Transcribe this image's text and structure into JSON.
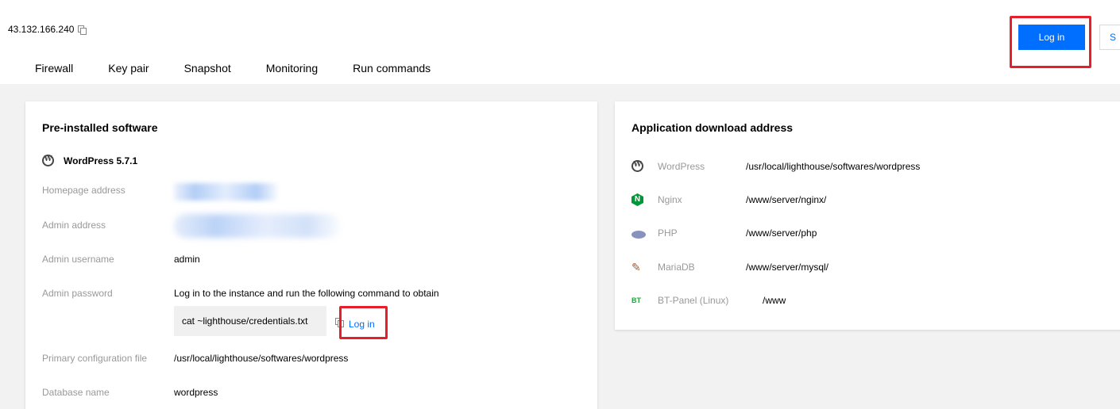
{
  "header": {
    "ip": "43.132.166.240",
    "login_button": "Log in",
    "secondary_button": "S"
  },
  "tabs": [
    "Firewall",
    "Key pair",
    "Snapshot",
    "Monitoring",
    "Run commands"
  ],
  "preinstalled": {
    "title": "Pre-installed software",
    "software_name": "WordPress 5.7.1",
    "fields": {
      "homepage_label": "Homepage address",
      "admin_address_label": "Admin address",
      "admin_username_label": "Admin username",
      "admin_username_value": "admin",
      "admin_password_label": "Admin password",
      "admin_password_hint": "Log in to the instance and run the following command to obtain",
      "command": "cat ~lighthouse/credentials.txt",
      "login_link": "Log in",
      "config_label": "Primary configuration file",
      "config_value": "/usr/local/lighthouse/softwares/wordpress",
      "db_label": "Database name",
      "db_value": "wordpress"
    }
  },
  "apps": {
    "title": "Application download address",
    "items": [
      {
        "icon": "wordpress-icon",
        "name": "WordPress",
        "path": "/usr/local/lighthouse/softwares/wordpress"
      },
      {
        "icon": "nginx-icon",
        "name": "Nginx",
        "path": "/www/server/nginx/"
      },
      {
        "icon": "php-icon",
        "name": "PHP",
        "path": "/www/server/php"
      },
      {
        "icon": "mariadb-icon",
        "name": "MariaDB",
        "path": "/www/server/mysql/"
      },
      {
        "icon": "bt-panel-icon",
        "name": "BT-Panel (Linux)",
        "path": "/www"
      }
    ]
  },
  "colors": {
    "primary": "#006eff",
    "highlight_border": "#e5202a",
    "background": "#f2f2f2"
  }
}
